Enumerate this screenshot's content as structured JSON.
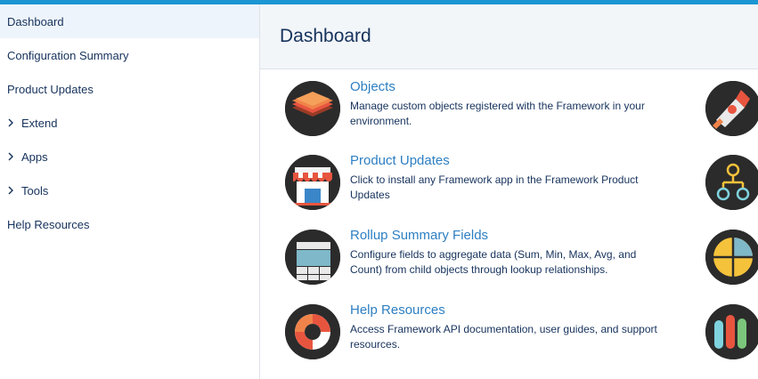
{
  "sidebar": {
    "items": [
      {
        "label": "Dashboard",
        "expandable": false,
        "active": true
      },
      {
        "label": "Configuration Summary",
        "expandable": false,
        "active": false
      },
      {
        "label": "Product Updates",
        "expandable": false,
        "active": false
      },
      {
        "label": "Extend",
        "expandable": true,
        "active": false
      },
      {
        "label": "Apps",
        "expandable": true,
        "active": false
      },
      {
        "label": "Tools",
        "expandable": true,
        "active": false
      },
      {
        "label": "Help Resources",
        "expandable": false,
        "active": false
      }
    ]
  },
  "header": {
    "title": "Dashboard"
  },
  "cards": [
    {
      "title": "Objects",
      "description": "Manage custom objects registered with the Framework in your environment.",
      "icon": "layers-icon"
    },
    {
      "title": "Product Updates",
      "description": "Click to install any Framework app in the Framework Product Updates",
      "icon": "store-icon"
    },
    {
      "title": "Rollup Summary Fields",
      "description": "Configure fields to aggregate data (Sum, Min, Max, Avg, and Count) from child objects through lookup relationships.",
      "icon": "table-icon"
    },
    {
      "title": "Help Resources",
      "description": "Access Framework API documentation, user guides, and support resources.",
      "icon": "life-ring-icon"
    }
  ],
  "right_icons": [
    "rocket-icon",
    "hierarchy-icon",
    "pie-icon",
    "bars-icon"
  ],
  "colors": {
    "accent": "#1b96d2",
    "link": "#2d7fc3",
    "text": "#16325c",
    "header_bg": "#f3f6f9",
    "active_bg": "#eef4fb"
  }
}
